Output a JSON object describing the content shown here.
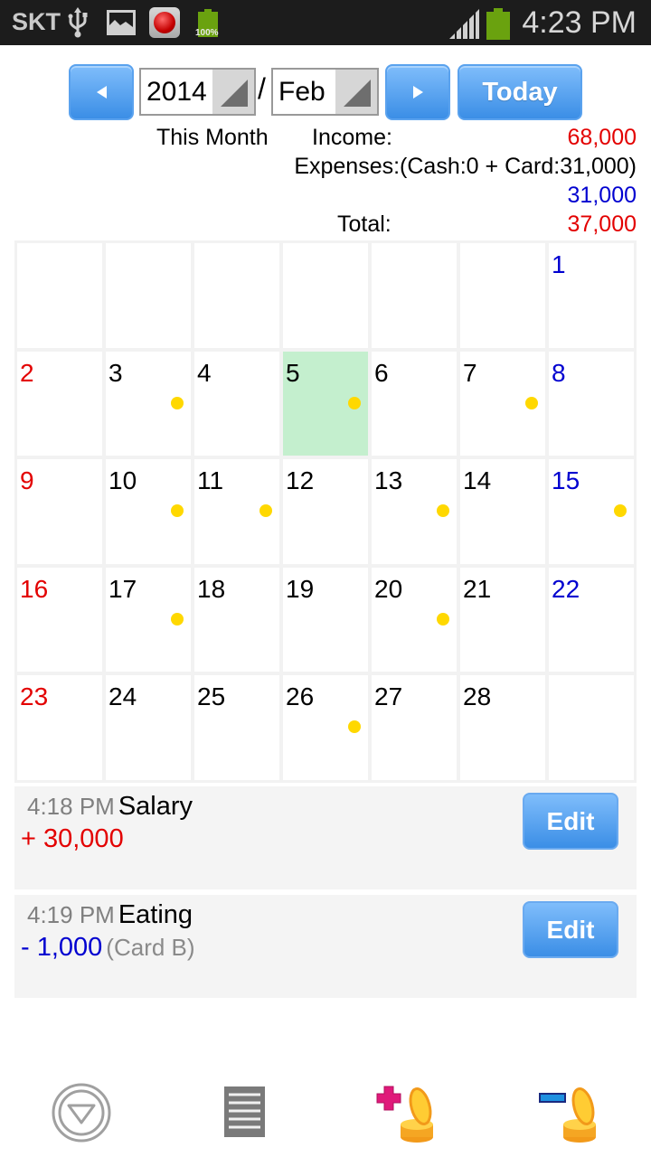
{
  "status_bar": {
    "carrier": "SKT",
    "battery_small_label": "100%",
    "time": "4:23 PM",
    "icons": [
      "usb-icon",
      "image-icon",
      "record-icon",
      "battery-icon",
      "signal-icon",
      "battery-icon"
    ]
  },
  "header": {
    "prev_icon": "chevron-left-icon",
    "next_icon": "chevron-right-icon",
    "year": "2014",
    "separator": "/",
    "month": "Feb",
    "today_label": "Today"
  },
  "summary": {
    "period_label": "This Month",
    "income_label": "Income:",
    "income_value": "68,000",
    "expenses_label": "Expenses:(Cash:0 + Card:31,000)",
    "expenses_value": "31,000",
    "total_label": "Total:",
    "total_value": "37,000"
  },
  "calendar": {
    "selected_day": 5,
    "weeks": [
      [
        null,
        null,
        null,
        null,
        null,
        null,
        1
      ],
      [
        2,
        3,
        4,
        5,
        6,
        7,
        8
      ],
      [
        9,
        10,
        11,
        12,
        13,
        14,
        15
      ],
      [
        16,
        17,
        18,
        19,
        20,
        21,
        22
      ],
      [
        23,
        24,
        25,
        26,
        27,
        28,
        null
      ]
    ],
    "days_with_entries": [
      3,
      5,
      7,
      10,
      11,
      13,
      15,
      17,
      20,
      26
    ]
  },
  "entries": [
    {
      "time": "4:18 PM",
      "title": "Salary",
      "amount": "+ 30,000",
      "type": "income",
      "detail": "",
      "edit_label": "Edit"
    },
    {
      "time": "4:19 PM",
      "title": "Eating",
      "amount": "- 1,000",
      "type": "expense",
      "detail": "(Card B)",
      "edit_label": "Edit"
    }
  ],
  "toolbar": {
    "items": [
      {
        "icon": "menu-down-circle-icon"
      },
      {
        "icon": "list-icon"
      },
      {
        "icon": "add-income-coins-icon"
      },
      {
        "icon": "add-expense-coins-icon"
      }
    ]
  },
  "colors": {
    "income": "#e30000",
    "expense": "#0000d0",
    "accent_button": "#3b8ee6",
    "today_highlight": "#c4efce",
    "entry_dot": "#ffd800"
  }
}
